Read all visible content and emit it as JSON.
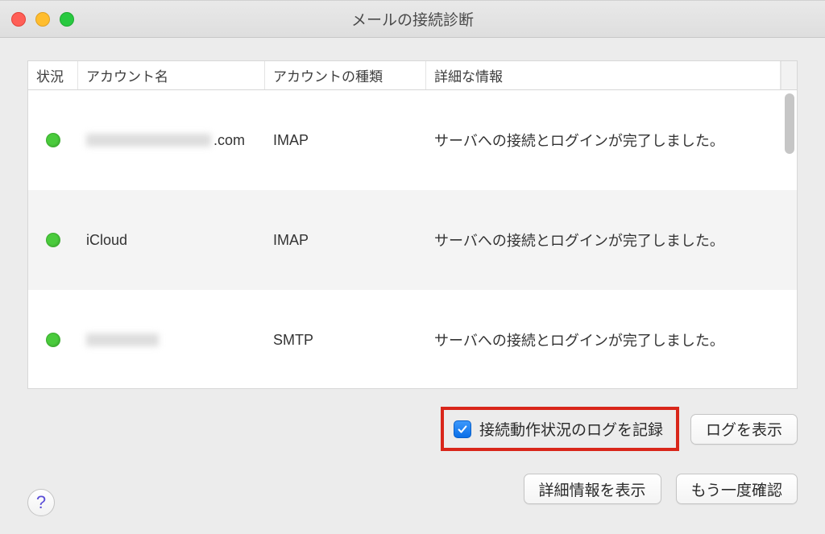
{
  "window": {
    "title": "メールの接続診断"
  },
  "columns": {
    "status": "状況",
    "account_name": "アカウント名",
    "account_type": "アカウントの種類",
    "details": "詳細な情報"
  },
  "rows": [
    {
      "status_color": "#4acb3c",
      "name_blurred": true,
      "name_suffix": ".com",
      "type": "IMAP",
      "details": "サーバへの接続とログインが完了しました。"
    },
    {
      "status_color": "#4acb3c",
      "name_blurred": false,
      "name": "iCloud",
      "type": "IMAP",
      "details": "サーバへの接続とログインが完了しました。"
    },
    {
      "status_color": "#4acb3c",
      "name_blurred": true,
      "name_suffix": "",
      "type": "SMTP",
      "details": "サーバへの接続とログインが完了しました。"
    }
  ],
  "checkbox": {
    "checked": true,
    "label": "接続動作状況のログを記録"
  },
  "buttons": {
    "show_log": "ログを表示",
    "show_details": "詳細情報を表示",
    "check_again": "もう一度確認",
    "help": "?"
  }
}
